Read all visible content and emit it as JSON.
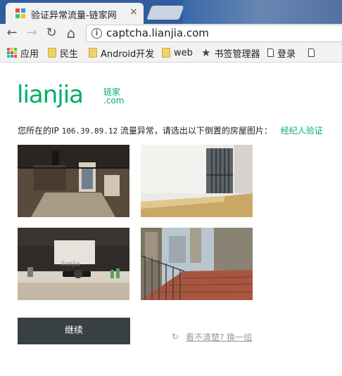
{
  "browser": {
    "tab_title": "验证异常流量-链家网",
    "tab_close": "×",
    "url": "captcha.lianjia.com",
    "nav": {
      "back": "←",
      "forward": "→",
      "reload": "↻",
      "home": "⌂"
    },
    "bookmarks": [
      {
        "label": "应用",
        "icon": "apps-grid-icon"
      },
      {
        "label": "民生",
        "icon": "folder-icon"
      },
      {
        "label": "Android开发",
        "icon": "folder-icon"
      },
      {
        "label": "web",
        "icon": "folder-icon"
      },
      {
        "label": "书签管理器",
        "icon": "star-icon"
      },
      {
        "label": "登录",
        "icon": "page-icon"
      },
      {
        "label": "",
        "icon": "page-icon"
      }
    ]
  },
  "logo": {
    "text": "lianjia",
    "cn": "链家",
    "com": ".com"
  },
  "captcha": {
    "prompt_prefix": "您所在的IP",
    "ip": "106.39.89.12",
    "prompt_suffix": "流量异常，请选出以下倒置的房屋图片：",
    "agent_link": "经纪人验证",
    "images": [
      {
        "name": "room-upside-down",
        "orientation": "inverted"
      },
      {
        "name": "window-room",
        "orientation": "inverted"
      },
      {
        "name": "kitchen",
        "orientation": "upright",
        "watermark": "lianjia"
      },
      {
        "name": "balcony",
        "orientation": "upright"
      }
    ],
    "continue_label": "继续",
    "refresh_icon": "↻",
    "refresh_label": "看不清楚? 换一组"
  },
  "colors": {
    "brand": "#00ae66",
    "button": "#394043",
    "tabstrip": "#2f5d9e"
  }
}
